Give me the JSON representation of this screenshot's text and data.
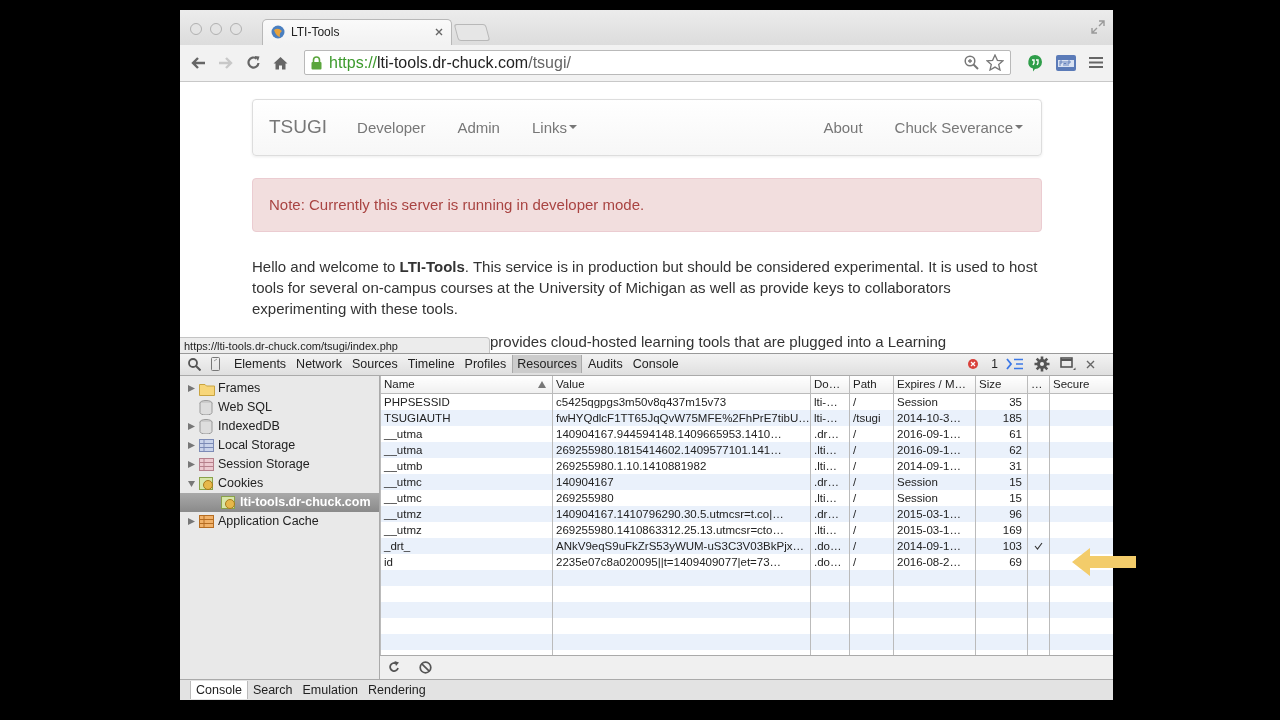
{
  "browser": {
    "tab": {
      "title": "LTI-Tools"
    },
    "url": {
      "scheme": "https://",
      "host": "lti-tools.dr-chuck.com",
      "path": "/tsugi/"
    }
  },
  "page": {
    "navbar": {
      "brand": "TSUGI",
      "left": [
        {
          "label": "Developer",
          "dropdown": false
        },
        {
          "label": "Admin",
          "dropdown": false
        },
        {
          "label": "Links",
          "dropdown": true
        }
      ],
      "right": [
        {
          "label": "About",
          "dropdown": false
        },
        {
          "label": "Chuck Severance",
          "dropdown": true
        }
      ]
    },
    "alert": "Note: Currently this server is running in developer mode.",
    "paragraph": "Hello and welcome to **LTI-Tools**. This service is in production but should be considered experimental. It is used to host tools for several on-campus courses at the University of Michigan as well as provide keys to collaborators experimenting with these tools.",
    "paragraph_2_visible": "provides cloud-hosted learning tools that are plugged into a Learning",
    "status_link": "https://lti-tools.dr-chuck.com/tsugi/index.php"
  },
  "devtools": {
    "tabs": [
      {
        "label": "Elements",
        "selected": false
      },
      {
        "label": "Network",
        "selected": false
      },
      {
        "label": "Sources",
        "selected": false
      },
      {
        "label": "Timeline",
        "selected": false
      },
      {
        "label": "Profiles",
        "selected": false
      },
      {
        "label": "Resources",
        "selected": true
      },
      {
        "label": "Audits",
        "selected": false
      },
      {
        "label": "Console",
        "selected": false
      }
    ],
    "error_count": "1",
    "sidebar": {
      "items": [
        {
          "label": "Frames",
          "kind": "folder",
          "expanded": false,
          "selected": false
        },
        {
          "label": "Web SQL",
          "kind": "database",
          "selected": false
        },
        {
          "label": "IndexedDB",
          "kind": "database",
          "expanded": false,
          "selected": false
        },
        {
          "label": "Local Storage",
          "kind": "grid",
          "expanded": false,
          "selected": false
        },
        {
          "label": "Session Storage",
          "kind": "grid-red",
          "expanded": false,
          "selected": false
        },
        {
          "label": "Cookies",
          "kind": "cookie",
          "expanded": true,
          "selected": false,
          "children": [
            {
              "label": "lti-tools.dr-chuck.com",
              "kind": "cookie",
              "selected": true
            }
          ]
        },
        {
          "label": "Application Cache",
          "kind": "grid-orange",
          "expanded": false,
          "selected": false
        }
      ]
    },
    "table": {
      "columns": [
        "Name",
        "Value",
        "Do…",
        "Path",
        "Expires / M…",
        "Size",
        "…",
        "Secure"
      ],
      "rows": [
        {
          "name": "PHPSESSID",
          "value": "c5425qgpgs3m50v8q437m15v73",
          "domain": "lti-…",
          "path": "/",
          "expires": "Session",
          "size": "35",
          "http_only": false
        },
        {
          "name": "TSUGIAUTH",
          "value": "fwHYQdlcF1TT65JqQvW75MFE%2FhPrE7tibU…",
          "domain": "lti-…",
          "path": "/tsugi",
          "expires": "2014-10-3…",
          "size": "185",
          "http_only": false
        },
        {
          "name": "__utma",
          "value": "140904167.944594148.1409665953.1410…",
          "domain": ".dr…",
          "path": "/",
          "expires": "2016-09-1…",
          "size": "61",
          "http_only": false
        },
        {
          "name": "__utma",
          "value": "269255980.1815414602.1409577101.141…",
          "domain": ".lti…",
          "path": "/",
          "expires": "2016-09-1…",
          "size": "62",
          "http_only": false
        },
        {
          "name": "__utmb",
          "value": "269255980.1.10.1410881982",
          "domain": ".lti…",
          "path": "/",
          "expires": "2014-09-1…",
          "size": "31",
          "http_only": false
        },
        {
          "name": "__utmc",
          "value": "140904167",
          "domain": ".dr…",
          "path": "/",
          "expires": "Session",
          "size": "15",
          "http_only": false
        },
        {
          "name": "__utmc",
          "value": "269255980",
          "domain": ".lti…",
          "path": "/",
          "expires": "Session",
          "size": "15",
          "http_only": false
        },
        {
          "name": "__utmz",
          "value": "140904167.1410796290.30.5.utmcsr=t.co|…",
          "domain": ".dr…",
          "path": "/",
          "expires": "2015-03-1…",
          "size": "96",
          "http_only": false
        },
        {
          "name": "__utmz",
          "value": "269255980.1410863312.25.13.utmcsr=cto…",
          "domain": ".lti…",
          "path": "/",
          "expires": "2015-03-1…",
          "size": "169",
          "http_only": false
        },
        {
          "name": "_drt_",
          "value": "ANkV9eqS9uFkZrS53yWUM-uS3C3V03BkPjx…",
          "domain": ".do…",
          "path": "/",
          "expires": "2014-09-1…",
          "size": "103",
          "http_only": true
        },
        {
          "name": "id",
          "value": "2235e07c8a020095||t=1409409077|et=73…",
          "domain": ".do…",
          "path": "/",
          "expires": "2016-08-2…",
          "size": "69",
          "http_only": false
        }
      ]
    },
    "drawer_tabs": [
      {
        "label": "Console",
        "selected": true
      },
      {
        "label": "Search",
        "selected": false
      },
      {
        "label": "Emulation",
        "selected": false
      },
      {
        "label": "Rendering",
        "selected": false
      }
    ]
  }
}
